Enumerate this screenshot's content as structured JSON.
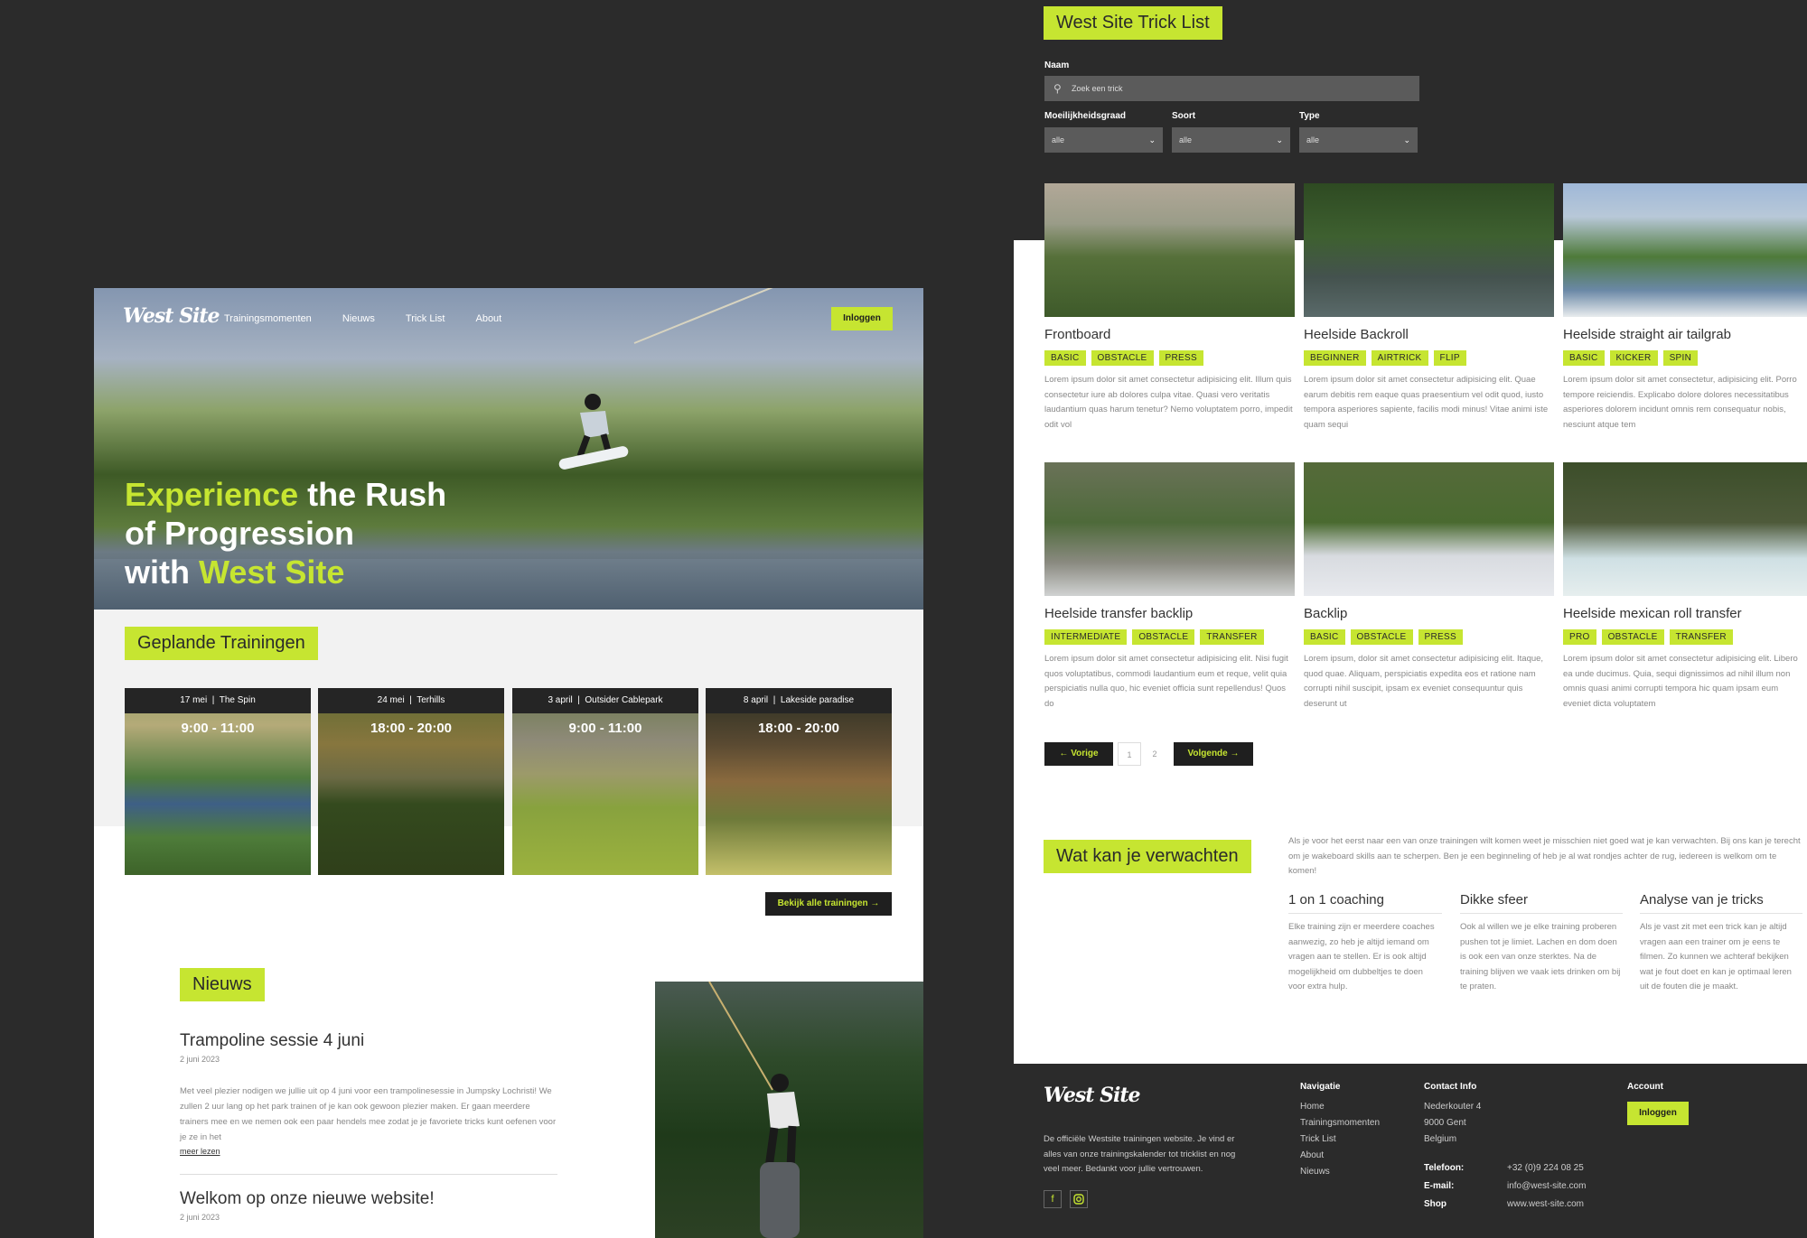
{
  "left": {
    "brand": "West Site",
    "nav": [
      "Trainingsmomenten",
      "Nieuws",
      "Trick List",
      "About"
    ],
    "login": "Inloggen",
    "hero": {
      "line1a": "Experience",
      "line1b": " the Rush",
      "line2": "of Progression",
      "line3a": "with ",
      "line3b": "West Site"
    },
    "trainings_title": "Geplande Trainingen",
    "trainings": [
      {
        "date": "17 mei",
        "place": "The Spin",
        "time": "9:00 - 11:00"
      },
      {
        "date": "24 mei",
        "place": "Terhills",
        "time": "18:00 - 20:00"
      },
      {
        "date": "3 april",
        "place": "Outsider Cablepark",
        "time": "9:00 - 11:00"
      },
      {
        "date": "8 april",
        "place": "Lakeside paradise",
        "time": "18:00 - 20:00"
      }
    ],
    "all_trainings": "Bekijk alle trainingen",
    "news_title": "Nieuws",
    "news": [
      {
        "title": "Trampoline sessie 4 juni",
        "date": "2 juni 2023",
        "body": "Met veel plezier nodigen we jullie uit op 4 juni voor een trampolinesessie in Jumpsky Lochristi! We zullen 2 uur lang op het park trainen of je kan ook gewoon plezier maken. Er gaan meerdere trainers mee en we nemen ook een paar hendels mee zodat je je favoriete tricks kunt oefenen voor je ze in het",
        "more": "meer lezen"
      },
      {
        "title": "Welkom op onze nieuwe website!",
        "date": "2 juni 2023"
      }
    ]
  },
  "right": {
    "title": "West Site Trick List",
    "search_label": "Naam",
    "search_placeholder": "Zoek een trick",
    "filters": [
      {
        "label": "Moeilijkheidsgraad",
        "value": "alle"
      },
      {
        "label": "Soort",
        "value": "alle"
      },
      {
        "label": "Type",
        "value": "alle"
      }
    ],
    "tricks": [
      {
        "title": "Frontboard",
        "tags": [
          "BASIC",
          "OBSTACLE",
          "PRESS"
        ],
        "desc": "Lorem ipsum dolor sit amet consectetur adipisicing elit. Illum quis consectetur iure ab dolores culpa vitae. Quasi vero veritatis laudantium quas harum tenetur? Nemo voluptatem porro, impedit odit vol"
      },
      {
        "title": "Heelside Backroll",
        "tags": [
          "BEGINNER",
          "AIRTRICK",
          "FLIP"
        ],
        "desc": "Lorem ipsum dolor sit amet consectetur adipisicing elit. Quae earum debitis rem eaque quas praesentium vel odit quod, iusto tempora asperiores sapiente, facilis modi minus! Vitae animi iste quam sequi"
      },
      {
        "title": "Heelside straight air tailgrab",
        "tags": [
          "BASIC",
          "KICKER",
          "SPIN"
        ],
        "desc": "Lorem ipsum dolor sit amet consectetur, adipisicing elit. Porro tempore reiciendis. Explicabo dolore dolores necessitatibus asperiores dolorem incidunt omnis rem consequatur nobis, nesciunt atque tem"
      },
      {
        "title": "Heelside transfer backlip",
        "tags": [
          "INTERMEDIATE",
          "OBSTACLE",
          "TRANSFER"
        ],
        "desc": "Lorem ipsum dolor sit amet consectetur adipisicing elit. Nisi fugit quos voluptatibus, commodi laudantium eum et reque, velit quia perspiciatis nulla quo, hic eveniet officia sunt repellendus! Quos do"
      },
      {
        "title": "Backlip",
        "tags": [
          "BASIC",
          "OBSTACLE",
          "PRESS"
        ],
        "desc": "Lorem ipsum, dolor sit amet consectetur adipisicing elit. Itaque, quod quae. Aliquam, perspiciatis expedita eos et ratione nam corrupti nihil suscipit, ipsam ex eveniet consequuntur quis deserunt ut"
      },
      {
        "title": "Heelside mexican roll transfer",
        "tags": [
          "PRO",
          "OBSTACLE",
          "TRANSFER"
        ],
        "desc": "Lorem ipsum dolor sit amet consectetur adipisicing elit. Libero ea unde ducimus. Quia, sequi dignissimos ad nihil illum non omnis quasi animi corrupti tempora hic quam ipsam eum eveniet dicta voluptatem"
      }
    ],
    "pager": {
      "prev": "Vorige",
      "p1": "1",
      "p2": "2",
      "next": "Volgende"
    },
    "expect_title": "Wat kan je verwachten",
    "expect_intro": "Als je voor het eerst naar een van onze trainingen wilt komen weet je misschien niet goed wat je kan verwachten. Bij ons kan je terecht om je wakeboard skills aan te scherpen. Ben je een beginneling of heb je al wat rondjes achter de rug, iedereen is welkom om te komen!",
    "expect": [
      {
        "title": "1 on 1 coaching",
        "desc": "Elke training zijn er meerdere coaches aanwezig, zo heb je altijd iemand om vragen aan te stellen. Er is ook altijd mogelijkheid om dubbeltjes te doen voor extra hulp."
      },
      {
        "title": "Dikke sfeer",
        "desc": "Ook al willen we je elke training proberen pushen tot je limiet. Lachen en dom doen is ook een van onze sterktes. Na de training blijven we vaak iets drinken om bij te praten."
      },
      {
        "title": "Analyse van je tricks",
        "desc": "Als je vast zit met een trick kan je altijd vragen aan een trainer om je eens te filmen. Zo kunnen we achteraf bekijken wat je fout doet en kan je optimaal leren uit de fouten die je maakt."
      }
    ],
    "footer": {
      "about": "De officiële Westsite trainingen website. Je vind er alles van onze trainingskalender tot tricklist en nog veel meer. Bedankt voor jullie vertrouwen.",
      "nav_head": "Navigatie",
      "nav": [
        "Home",
        "Trainingsmomenten",
        "Trick List",
        "About",
        "Nieuws"
      ],
      "contact_head": "Contact Info",
      "address": [
        "Nederkouter 4",
        "9000 Gent",
        "Belgium"
      ],
      "phone_label": "Telefoon:",
      "phone": "+32 (0)9 224 08 25",
      "email_label": "E-mail:",
      "email": "info@west-site.com",
      "shop_label": "Shop",
      "shop": "www.west-site.com",
      "account_head": "Account",
      "login": "Inloggen"
    }
  },
  "colors": {
    "accent": "#c6e531",
    "dark": "#2b2b2b",
    "button": "#1f1f1f"
  }
}
